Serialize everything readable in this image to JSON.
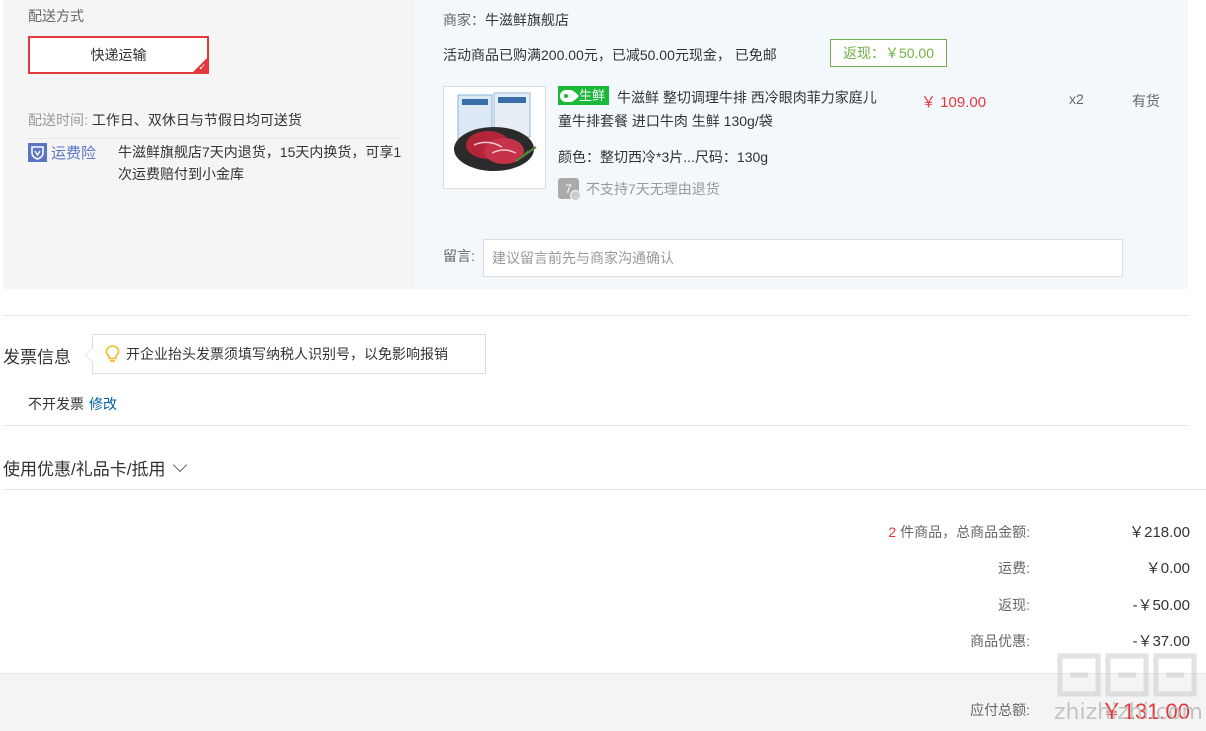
{
  "shipping": {
    "title": "配送方式",
    "method_label": "快递运输",
    "time_label": "配送时间:",
    "time_value": "工作日、双休日与节假日均可送货",
    "insurance_icon": "shield-icon",
    "insurance_label": "运费险",
    "insurance_desc": "牛滋鲜旗舰店7天内退货，15天内换货，可享1次运费赔付到小金库"
  },
  "order": {
    "seller_label": "商家：",
    "seller_name": "牛滋鲜旗舰店",
    "promo_text": "活动商品已购满200.00元，已减50.00元现金， 已免邮",
    "cashback_tag": "返现：￥50.00",
    "product": {
      "tag": "生鲜",
      "title": "牛滋鲜 整切调理牛排 西冷眼肉菲力家庭儿童牛排套餐 进口牛肉 生鲜 130g/袋",
      "price": "￥ 109.00",
      "quantity": "x2",
      "stock": "有货",
      "spec": "颜色：整切西冷*3片...尺码：130g",
      "return_icon_text": "7",
      "return_policy": "不支持7天无理由退货"
    },
    "message_label": "留言:",
    "message_placeholder": "建议留言前先与商家沟通确认"
  },
  "invoice": {
    "title": "发票信息",
    "tip": "开企业抬头发票须填写纳税人识别号，以免影响报销",
    "value": "不开发票",
    "edit_label": "修改"
  },
  "coupon": {
    "label": "使用优惠/礼品卡/抵用"
  },
  "summary": {
    "item_count": "2",
    "items_label": "件商品，总商品金额:",
    "items_total": "￥218.00",
    "shipping_label": "运费:",
    "shipping_value": "￥0.00",
    "cashback_label": "返现:",
    "cashback_value": "-￥50.00",
    "discount_label": "商品优惠:",
    "discount_value": "-￥37.00",
    "total_label": "应付总额:",
    "total_value": "￥131.00"
  },
  "watermark": {
    "text": "zhizhizhi.com"
  },
  "colors": {
    "accent_red": "#e4393c",
    "link_blue": "#005ea7",
    "fresh_green": "#1cb839",
    "cashback_green": "#71b247",
    "insurance_blue": "#5b74c4"
  }
}
